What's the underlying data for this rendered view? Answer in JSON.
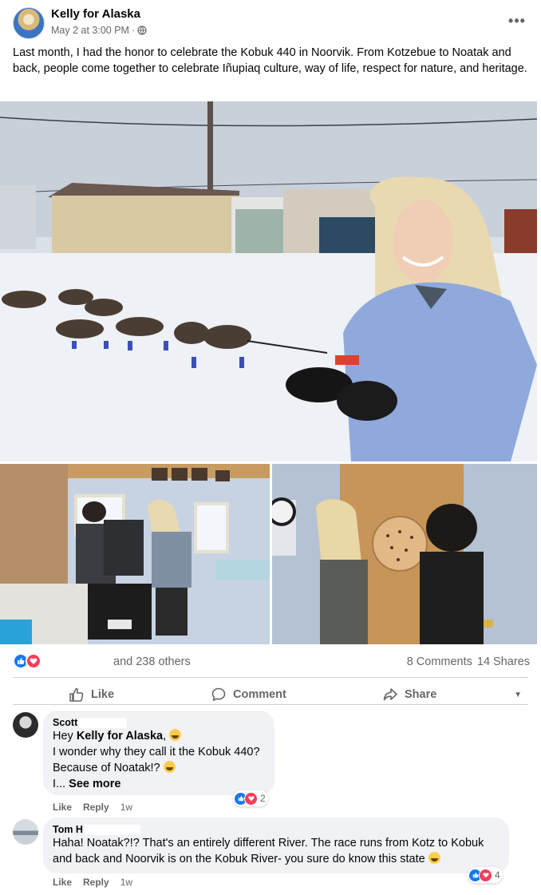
{
  "post": {
    "page_name": "Kelly for Alaska",
    "timestamp": "May 2 at 3:00 PM",
    "separator": "·",
    "privacy_icon": "globe-icon",
    "more_label": "•••",
    "text": "Last month, I had the honor to celebrate the Kobuk 440 in Noorvik. From Kotzebue to Noatak and back, people come together to celebrate Iñupiaq culture, way of life, respect for nature, and heritage."
  },
  "photos": [
    {
      "name": "dog-sled-team-photo"
    },
    {
      "name": "indoor-event-photo"
    },
    {
      "name": "dartboard-photo"
    }
  ],
  "reactions": {
    "icons": [
      "like-icon",
      "love-icon"
    ],
    "summary": "and 238 others",
    "comments_count": "8 Comments",
    "shares_count": "14 Shares"
  },
  "actions": {
    "like": "Like",
    "comment": "Comment",
    "share": "Share",
    "audience_caret": "▼"
  },
  "comments": [
    {
      "author": "Scott",
      "mention": "Kelly for Alaska",
      "greeting": "Hey",
      "line2": "I wonder why they call it the Kobuk 440?",
      "line3": "Because of Noatak!?",
      "ellipsis": "I...",
      "see_more": "See more",
      "like": "Like",
      "reply": "Reply",
      "time": "1w",
      "reaction_count": "2"
    },
    {
      "author": "Tom H",
      "body": "Haha! Noatak?!? That's an entirely different River. The race runs from Kotz to Kobuk and back and Noorvik is on the Kobuk River- you sure do know this state",
      "like": "Like",
      "reply": "Reply",
      "time": "1w",
      "reaction_count": "4"
    }
  ],
  "colors": {
    "secondary_text": "#65676b",
    "like_blue": "#1877f2",
    "love_red": "#f33e58",
    "bubble_bg": "#f0f2f5"
  }
}
